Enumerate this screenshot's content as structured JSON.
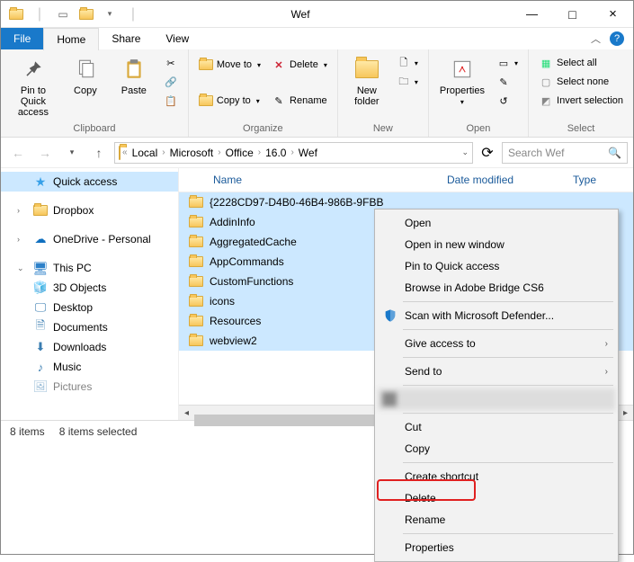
{
  "window": {
    "title": "Wef"
  },
  "tabs": {
    "file": "File",
    "home": "Home",
    "share": "Share",
    "view": "View"
  },
  "ribbon": {
    "clipboard": {
      "pin": "Pin to Quick\naccess",
      "copy": "Copy",
      "paste": "Paste",
      "label": "Clipboard"
    },
    "organize": {
      "moveto": "Move to",
      "copyto": "Copy to",
      "delete": "Delete",
      "rename": "Rename",
      "label": "Organize"
    },
    "new": {
      "newfolder": "New\nfolder",
      "label": "New"
    },
    "open": {
      "properties": "Properties",
      "label": "Open"
    },
    "select": {
      "selectall": "Select all",
      "selectnone": "Select none",
      "invert": "Invert selection",
      "label": "Select"
    }
  },
  "breadcrumb": [
    "Local",
    "Microsoft",
    "Office",
    "16.0",
    "Wef"
  ],
  "search": {
    "placeholder": "Search Wef"
  },
  "sidebar": {
    "quick": "Quick access",
    "dropbox": "Dropbox",
    "onedrive": "OneDrive - Personal",
    "thispc": "This PC",
    "objects3d": "3D Objects",
    "desktop": "Desktop",
    "documents": "Documents",
    "downloads": "Downloads",
    "music": "Music",
    "pictures": "Pictures"
  },
  "columns": {
    "name": "Name",
    "date": "Date modified",
    "type": "Type"
  },
  "files": [
    "{2228CD97-D4B0-46B4-986B-9FBB",
    "AddinInfo",
    "AggregatedCache",
    "AppCommands",
    "CustomFunctions",
    "icons",
    "Resources",
    "webview2"
  ],
  "status": {
    "count": "8 items",
    "selected": "8 items selected"
  },
  "context": {
    "open": "Open",
    "open_new": "Open in new window",
    "pin_qa": "Pin to Quick access",
    "bridge": "Browse in Adobe Bridge CS6",
    "defender": "Scan with Microsoft Defender...",
    "give": "Give access to",
    "sendto": "Send to",
    "blurred": "████████████",
    "cut": "Cut",
    "copy": "Copy",
    "shortcut": "Create shortcut",
    "delete": "Delete",
    "rename": "Rename",
    "properties": "Properties"
  }
}
